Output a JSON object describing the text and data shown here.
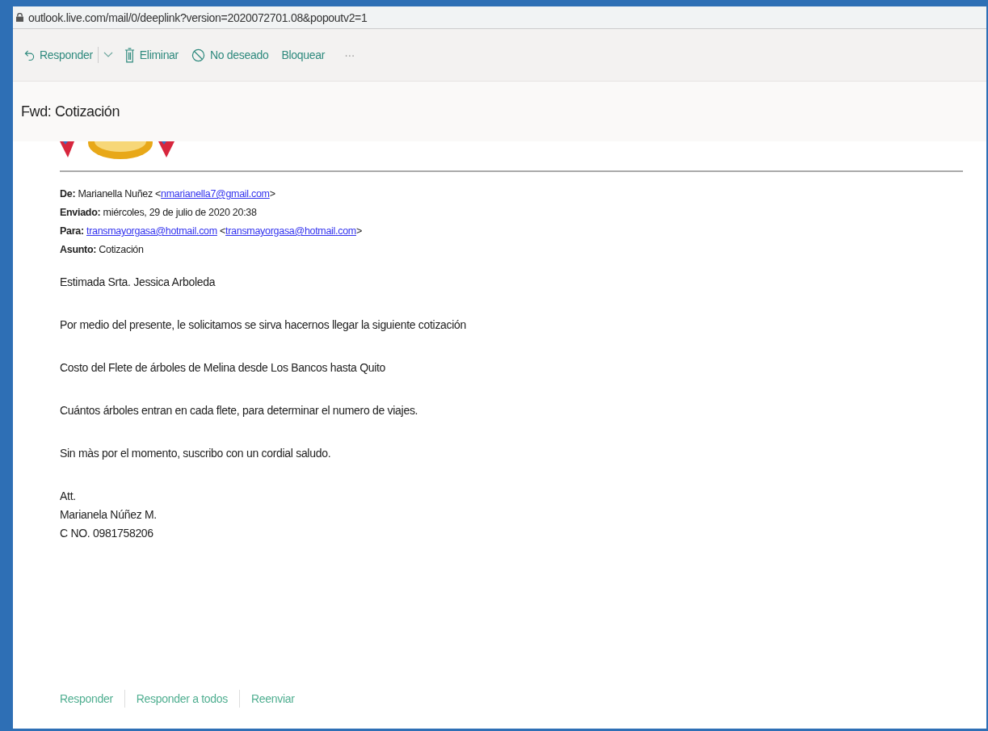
{
  "address_bar": {
    "url": "outlook.live.com/mail/0/deeplink?version=2020072701.08&popoutv2=1"
  },
  "toolbar": [
    {
      "kind": "reply",
      "label": "Responder"
    },
    {
      "kind": "dropdown"
    },
    {
      "kind": "delete",
      "label": "Eliminar"
    },
    {
      "kind": "junk",
      "label": "No deseado"
    },
    {
      "kind": "plain",
      "label": "Bloquear"
    },
    {
      "kind": "more",
      "label": "···"
    }
  ],
  "subject": "Fwd: Cotización",
  "logo": {
    "kind": "picture"
  },
  "headers": [
    {
      "label": "De:",
      "parts": [
        {
          "kind": "text",
          "text": "Marianella Nuñez <"
        },
        {
          "kind": "link",
          "text": "nmarianella7@gmail.com"
        },
        {
          "kind": "text",
          "text": ">"
        }
      ]
    },
    {
      "label": "Enviado:",
      "parts": [
        {
          "kind": "text",
          "text": "miércoles, 29 de julio de 2020 20:38"
        }
      ]
    },
    {
      "label": "Para:",
      "parts": [
        {
          "kind": "link",
          "text": "transmayorgasa@hotmail.com"
        },
        {
          "kind": "text",
          "text": " <"
        },
        {
          "kind": "link",
          "text": "transmayorgasa@hotmail.com"
        },
        {
          "kind": "text",
          "text": ">"
        }
      ]
    },
    {
      "label": "Asunto:",
      "parts": [
        {
          "kind": "text",
          "text": "Cotización"
        }
      ]
    }
  ],
  "body": [
    "Estimada Srta. Jessica Arboleda",
    "Por medio del presente, le solicitamos se sirva hacernos llegar la siguiente cotización",
    "Costo del Flete de árboles de Melina desde Los Bancos hasta Quito",
    "Cuántos árboles entran en cada flete, para determinar el numero de viajes.",
    "Sin màs por el momento, suscribo con un cordial saludo."
  ],
  "signature": [
    "Att.",
    "Marianela Núñez M.",
    "C NO. 0981758206"
  ],
  "actions": [
    "Responder",
    "Responder a todos",
    "Reenviar"
  ]
}
